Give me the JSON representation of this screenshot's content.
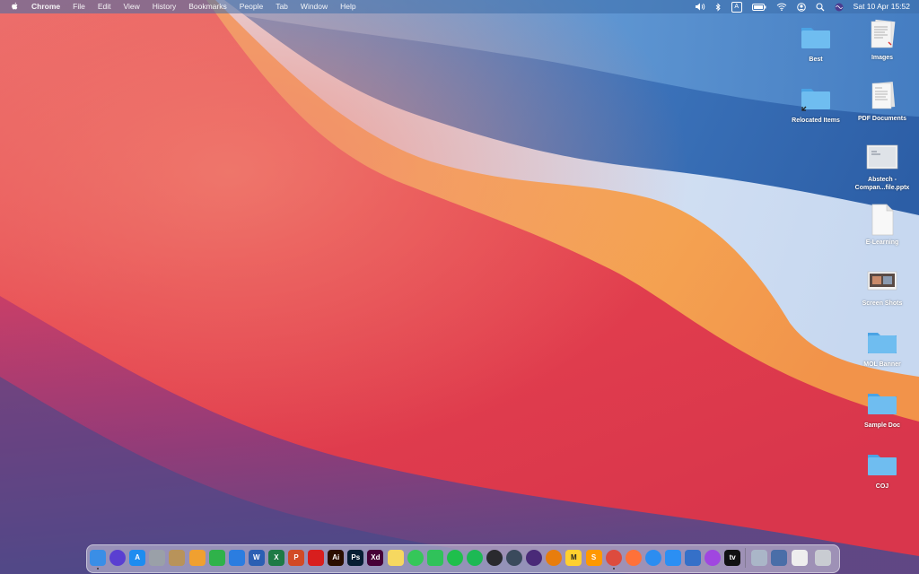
{
  "menubar": {
    "app_name": "Chrome",
    "menus": [
      "File",
      "Edit",
      "View",
      "History",
      "Bookmarks",
      "People",
      "Tab",
      "Window",
      "Help"
    ],
    "status_icons": [
      "volume-icon",
      "bluetooth-icon",
      "input-source-icon",
      "battery-icon",
      "wifi-icon",
      "user-icon",
      "spotlight-icon",
      "siri-icon"
    ],
    "input_source_label": "A",
    "clock": "Sat 10 Apr  15:52"
  },
  "desktop": {
    "items": [
      {
        "label": "Best",
        "kind": "folder"
      },
      {
        "label": "Images",
        "kind": "document-stack"
      },
      {
        "label": "Relocated Items",
        "kind": "folder-alias"
      },
      {
        "label": "PDF Documents",
        "kind": "document-stack"
      },
      {
        "label": "Abstech -\nCompan...file.pptx",
        "kind": "presentation"
      },
      {
        "label": "E-Learning",
        "kind": "blank-document"
      },
      {
        "label": "Screen Shots",
        "kind": "screenshot"
      },
      {
        "label": "MOL Banner",
        "kind": "folder"
      },
      {
        "label": "Sample Doc",
        "kind": "folder"
      },
      {
        "label": "COJ",
        "kind": "folder"
      }
    ]
  },
  "dock": {
    "apps": [
      {
        "name": "Finder",
        "icon": "finder-icon",
        "abbr": "",
        "color": "#3a8ee6",
        "running": true
      },
      {
        "name": "Siri",
        "icon": "siri-icon",
        "abbr": "",
        "color": "#5a3fd1",
        "running": false
      },
      {
        "name": "App Store",
        "icon": "app-store-icon",
        "abbr": "A",
        "color": "#1e8cf0",
        "running": false
      },
      {
        "name": "Launchpad",
        "icon": "launchpad-icon",
        "abbr": "",
        "color": "#9aa0a8",
        "running": false
      },
      {
        "name": "Contacts",
        "icon": "contacts-icon",
        "abbr": "",
        "color": "#b8935a",
        "running": false
      },
      {
        "name": "Pages",
        "icon": "pages-icon",
        "abbr": "",
        "color": "#f0a030",
        "running": false
      },
      {
        "name": "Numbers",
        "icon": "numbers-icon",
        "abbr": "",
        "color": "#2fb24a",
        "running": false
      },
      {
        "name": "Keynote",
        "icon": "keynote-icon",
        "abbr": "",
        "color": "#2b7de0",
        "running": false
      },
      {
        "name": "Word",
        "icon": "word-icon",
        "abbr": "W",
        "color": "#2b5fb3",
        "running": false
      },
      {
        "name": "Excel",
        "icon": "excel-icon",
        "abbr": "X",
        "color": "#1e7a45",
        "running": false
      },
      {
        "name": "PowerPoint",
        "icon": "powerpoint-icon",
        "abbr": "P",
        "color": "#d24a26",
        "running": false
      },
      {
        "name": "Acrobat",
        "icon": "acrobat-icon",
        "abbr": "",
        "color": "#d81e1e",
        "running": false
      },
      {
        "name": "Illustrator",
        "icon": "illustrator-icon",
        "abbr": "Ai",
        "color": "#2b0f00",
        "running": false
      },
      {
        "name": "Photoshop",
        "icon": "photoshop-icon",
        "abbr": "Ps",
        "color": "#061e33",
        "running": false
      },
      {
        "name": "Adobe XD",
        "icon": "xd-icon",
        "abbr": "Xd",
        "color": "#470137",
        "running": false
      },
      {
        "name": "Notes",
        "icon": "notes-icon",
        "abbr": "",
        "color": "#f6d860",
        "running": false
      },
      {
        "name": "Messages",
        "icon": "messages-icon",
        "abbr": "",
        "color": "#35c759",
        "running": false
      },
      {
        "name": "FaceTime",
        "icon": "facetime-icon",
        "abbr": "",
        "color": "#30c25a",
        "running": false
      },
      {
        "name": "LINE",
        "icon": "line-icon",
        "abbr": "",
        "color": "#1fbf4c",
        "running": false
      },
      {
        "name": "Spotify",
        "icon": "spotify-icon",
        "abbr": "",
        "color": "#1db954",
        "running": false
      },
      {
        "name": "OBS",
        "icon": "obs-icon",
        "abbr": "",
        "color": "#2a2a2e",
        "running": false
      },
      {
        "name": "QuickTime",
        "icon": "quicktime-icon",
        "abbr": "",
        "color": "#3a4a5c",
        "running": false
      },
      {
        "name": "Tor",
        "icon": "tor-icon",
        "abbr": "",
        "color": "#4a2a78",
        "running": false
      },
      {
        "name": "Blender",
        "icon": "blender-icon",
        "abbr": "",
        "color": "#e87d0d",
        "running": false
      },
      {
        "name": "Miro",
        "icon": "miro-icon",
        "abbr": "M",
        "color": "#ffd02f",
        "running": false
      },
      {
        "name": "Sublime Text",
        "icon": "sublime-icon",
        "abbr": "S",
        "color": "#ff9800",
        "running": false
      },
      {
        "name": "Chrome",
        "icon": "chrome-icon",
        "abbr": "",
        "color": "#dd4b3e",
        "running": true
      },
      {
        "name": "Firefox",
        "icon": "firefox-icon",
        "abbr": "",
        "color": "#ff7139",
        "running": false
      },
      {
        "name": "Safari",
        "icon": "safari-icon",
        "abbr": "",
        "color": "#2c8df0",
        "running": false
      },
      {
        "name": "Mail",
        "icon": "mail-icon",
        "abbr": "",
        "color": "#2b8ff3",
        "running": false
      },
      {
        "name": "Preview",
        "icon": "preview-icon",
        "abbr": "",
        "color": "#3570c8",
        "running": false
      },
      {
        "name": "Podcasts",
        "icon": "podcasts-icon",
        "abbr": "",
        "color": "#a046e0",
        "running": false
      },
      {
        "name": "Apple TV",
        "icon": "tv-icon",
        "abbr": "tv",
        "color": "#111111",
        "running": false
      },
      {
        "name": "Downloads",
        "icon": "downloads-stack-icon",
        "abbr": "",
        "color": "#aab6c8",
        "running": false
      },
      {
        "name": "Screenshots",
        "icon": "screenshots-stack-icon",
        "abbr": "",
        "color": "#4a6ea8",
        "running": false
      },
      {
        "name": "Documents",
        "icon": "documents-stack-icon",
        "abbr": "",
        "color": "#eeeeee",
        "running": false
      },
      {
        "name": "Trash",
        "icon": "trash-icon",
        "abbr": "",
        "color": "#c9ccd2",
        "running": false
      }
    ]
  },
  "colors": {
    "folder": "#6fbdf0",
    "folder_dark": "#4aa3e4",
    "menubar": "#3c6eaa"
  }
}
